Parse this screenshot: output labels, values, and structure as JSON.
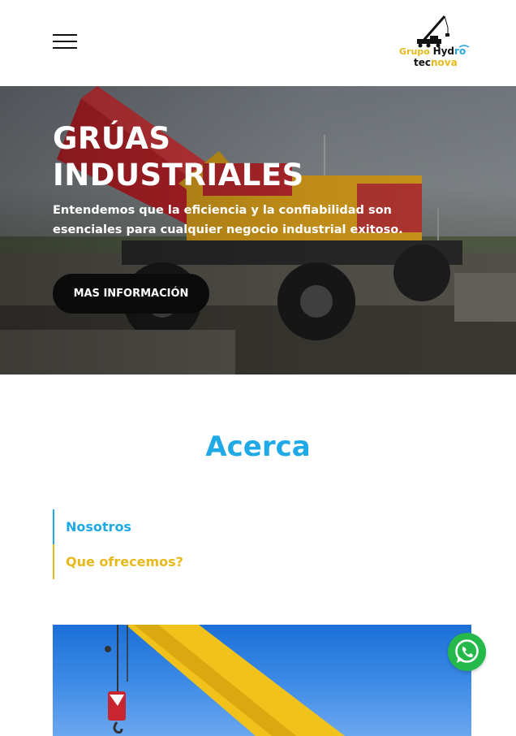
{
  "header": {
    "menu_icon": "hamburger-menu-icon",
    "logo": {
      "line1_a": "Grupo",
      "line1_b": "Hyd",
      "line1_c": "ro",
      "line2_a": "tec",
      "line2_b": "nova"
    }
  },
  "hero": {
    "title_line1": "GRÚAS",
    "title_line2": "INDUSTRIALES",
    "subtitle": "Entendemos que la eficiencia y la confiabilidad son esenciales para cualquier negocio industrial exitoso.",
    "button_label": "MAS INFORMACIÓN"
  },
  "about": {
    "title": "Acerca",
    "tabs": [
      {
        "label": "Nosotros",
        "color": "#1fa9e6"
      },
      {
        "label": "Que ofrecemos?",
        "color": "#e8b91a"
      }
    ]
  },
  "floating": {
    "whatsapp_icon": "whatsapp-icon"
  },
  "colors": {
    "accent_blue": "#1fa9e6",
    "accent_yellow": "#e8b91a",
    "button_black": "#0b0b0b",
    "whatsapp_green": "#25b84a"
  }
}
